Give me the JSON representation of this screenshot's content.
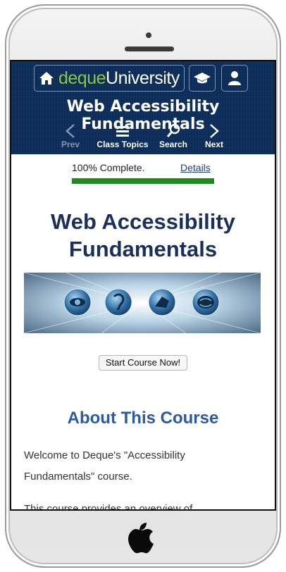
{
  "site": {
    "logo_part1": "deque",
    "logo_part2": "University",
    "title": "Web Accessibility Fundamentals"
  },
  "nav": [
    {
      "label": "Prev",
      "icon": "chevron-left-icon",
      "enabled": false
    },
    {
      "label": "Class Topics",
      "icon": "menu-icon",
      "enabled": true
    },
    {
      "label": "Search",
      "icon": "search-icon",
      "enabled": true
    },
    {
      "label": "Next",
      "icon": "chevron-right-icon",
      "enabled": true
    }
  ],
  "progress": {
    "text": "100% Complete.",
    "details_link": "Details",
    "fraction": 1.0
  },
  "content": {
    "course_title": "Web Accessibility Fundamentals",
    "start_button": "Start Course Now!",
    "about_heading": "About This Course",
    "intro_line1": "Welcome to Deque's \"Accessibility",
    "intro_line2": "Fundamentals\" course.",
    "overview_partial": "This course provides an overview of"
  },
  "colors": {
    "header_bg": "#0c2d5a",
    "logo_green": "#8dc63f",
    "progress_green": "#1f8a1f",
    "heading_blue": "#2c5aa0"
  }
}
